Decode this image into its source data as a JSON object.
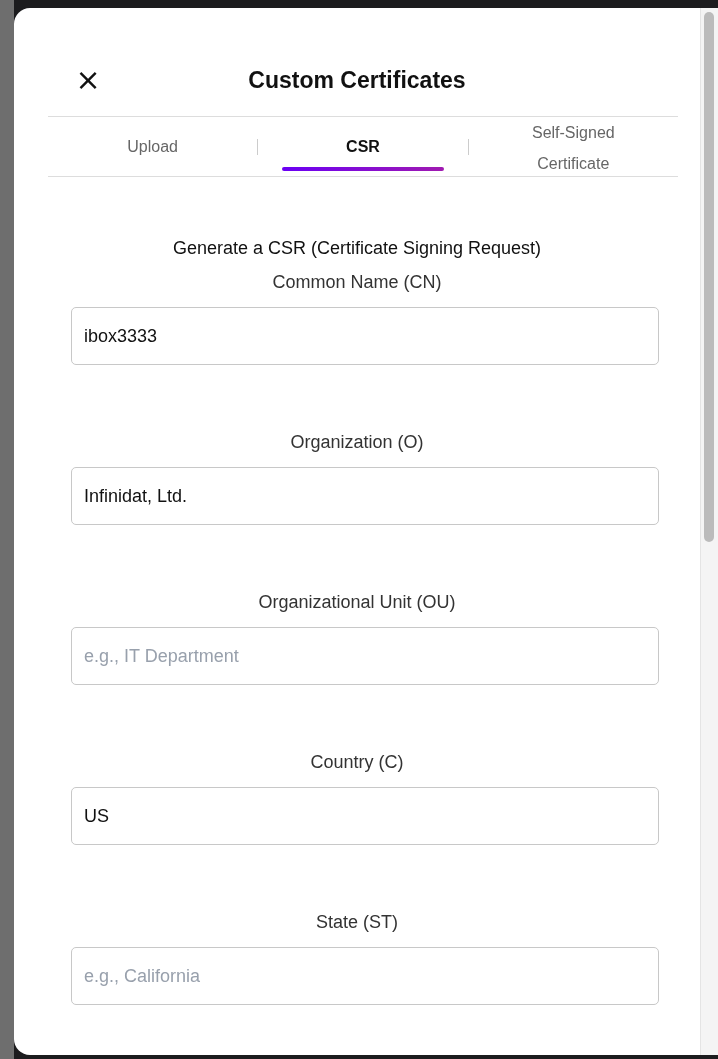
{
  "dialog": {
    "close_icon": "×",
    "title": "Custom Certificates"
  },
  "tabs": [
    {
      "label": "Upload",
      "selected": false
    },
    {
      "label": "CSR",
      "selected": true
    },
    {
      "label": "Self-Signed Certificate",
      "selected": false
    }
  ],
  "form": {
    "heading": "Generate a CSR (Certificate Signing Request)",
    "fields": [
      {
        "label": "Common Name (CN)",
        "value": "ibox3333"
      },
      {
        "label": "Organization (O)",
        "value": "Infinidat, Ltd."
      },
      {
        "label": "Organizational Unit (OU)",
        "placeholder": "e.g., IT Department"
      },
      {
        "label": "Country (C)",
        "value": "US"
      },
      {
        "label": "State (ST)",
        "placeholder": "e.g., California"
      }
    ]
  }
}
